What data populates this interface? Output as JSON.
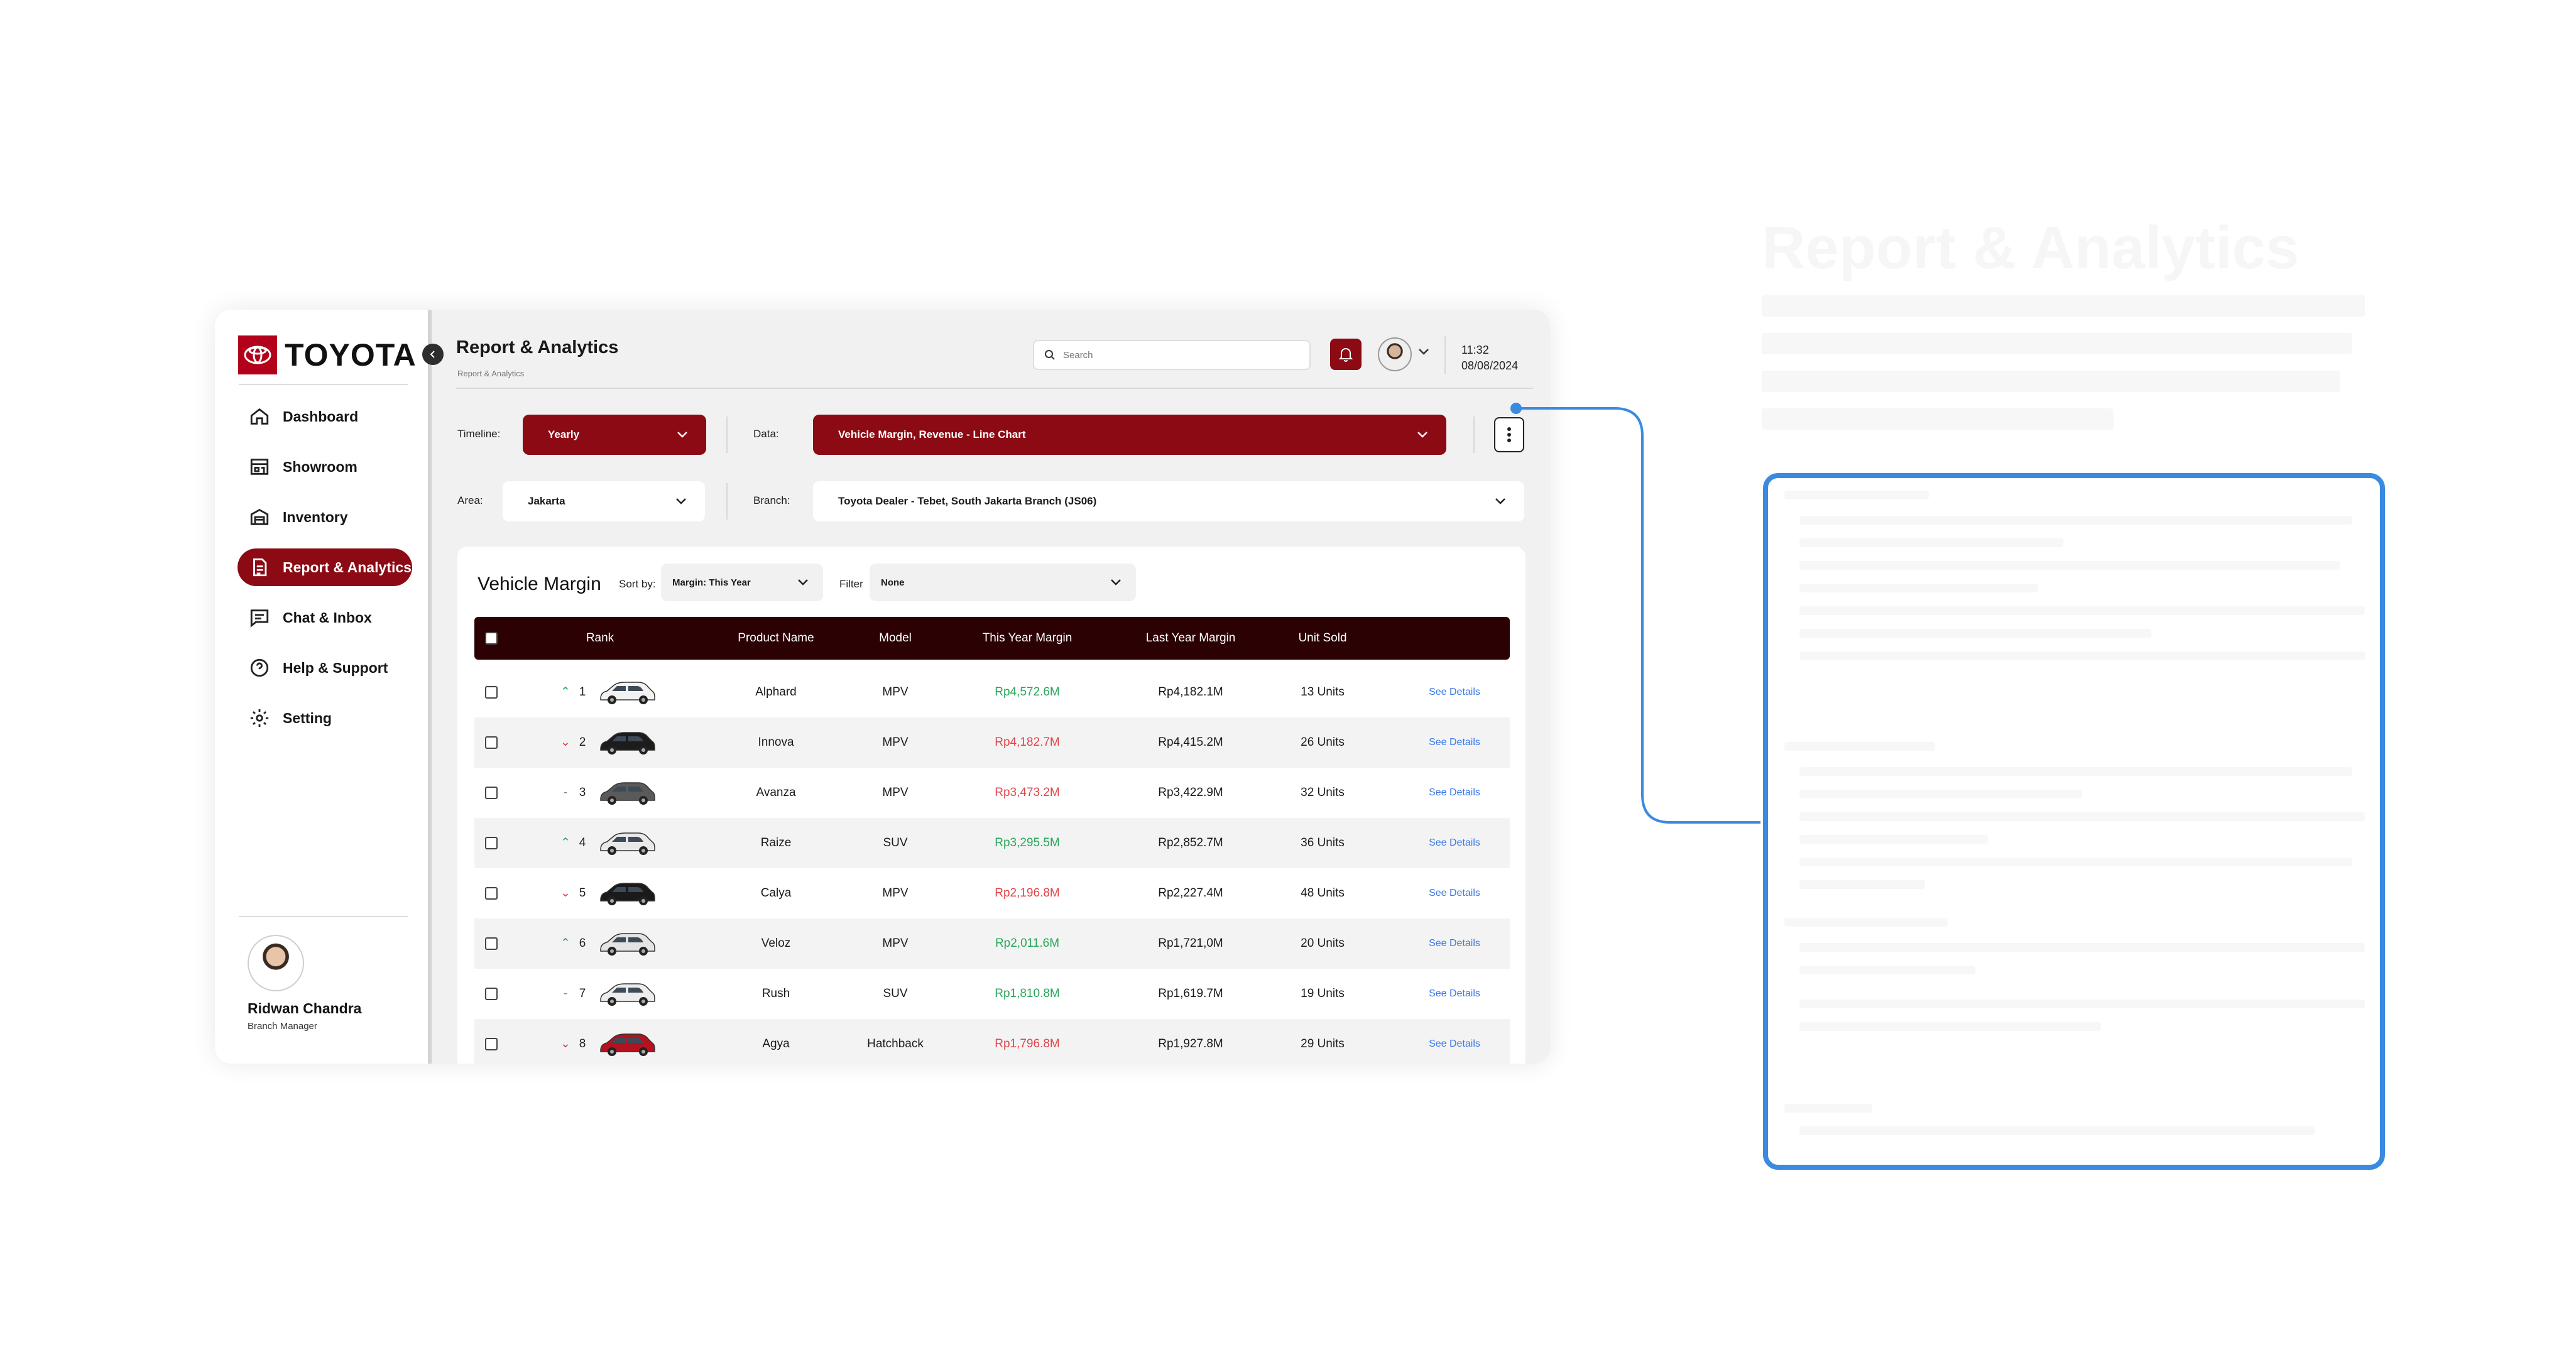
{
  "app": {
    "brand": "TOYOTA"
  },
  "sidebar": {
    "items": [
      {
        "label": "Dashboard",
        "icon": "home-icon",
        "active": false
      },
      {
        "label": "Showroom",
        "icon": "showroom-icon",
        "active": false
      },
      {
        "label": "Inventory",
        "icon": "warehouse-icon",
        "active": false
      },
      {
        "label": "Report & Analytics",
        "icon": "report-icon",
        "active": true
      },
      {
        "label": "Chat & Inbox",
        "icon": "chat-icon",
        "active": false
      },
      {
        "label": "Help & Support",
        "icon": "help-icon",
        "active": false
      },
      {
        "label": "Setting",
        "icon": "gear-icon",
        "active": false
      }
    ],
    "profile": {
      "name": "Ridwan Chandra",
      "role": "Branch Manager"
    }
  },
  "header": {
    "title": "Report & Analytics",
    "breadcrumb": "Report & Analytics",
    "search_placeholder": "Search",
    "time": "11:32",
    "date": "08/08/2024"
  },
  "filters": {
    "timeline_label": "Timeline:",
    "timeline_value": "Yearly",
    "data_label": "Data:",
    "data_value": "Vehicle Margin,  Revenue - Line Chart",
    "area_label": "Area:",
    "area_value": "Jakarta",
    "branch_label": "Branch:",
    "branch_value": "Toyota Dealer - Tebet, South Jakarta Branch  (JS06)"
  },
  "table_card": {
    "title": "Vehicle Margin",
    "sort_label": "Sort by:",
    "sort_value": "Margin: This Year",
    "filter_label": "Filter",
    "filter_value": "None",
    "columns": [
      "Rank",
      "Product Name",
      "Model",
      "This Year Margin",
      "Last Year Margin",
      "Unit Sold"
    ],
    "rows": [
      {
        "trend": "up",
        "rank": "1",
        "name": "Alphard",
        "model": "MPV",
        "this_year": "Rp4,572.6M",
        "this_year_color": "pos",
        "last_year": "Rp4,182.1M",
        "units": "13 Units",
        "action": "See Details",
        "car_color": "#f2f2f2"
      },
      {
        "trend": "down",
        "rank": "2",
        "name": "Innova",
        "model": "MPV",
        "this_year": "Rp4,182.7M",
        "this_year_color": "neg",
        "last_year": "Rp4,415.2M",
        "units": "26 Units",
        "action": "See Details",
        "car_color": "#1c1c1c"
      },
      {
        "trend": "flat",
        "rank": "3",
        "name": "Avanza",
        "model": "MPV",
        "this_year": "Rp3,473.2M",
        "this_year_color": "neg",
        "last_year": "Rp3,422.9M",
        "units": "32 Units",
        "action": "See Details",
        "car_color": "#5a5a5a"
      },
      {
        "trend": "up",
        "rank": "4",
        "name": "Raize",
        "model": "SUV",
        "this_year": "Rp3,295.5M",
        "this_year_color": "pos",
        "last_year": "Rp2,852.7M",
        "units": "36 Units",
        "action": "See Details",
        "car_color": "#e9e9e9"
      },
      {
        "trend": "down",
        "rank": "5",
        "name": "Calya",
        "model": "MPV",
        "this_year": "Rp2,196.8M",
        "this_year_color": "neg",
        "last_year": "Rp2,227.4M",
        "units": "48 Units",
        "action": "See Details",
        "car_color": "#1a1a1a"
      },
      {
        "trend": "up",
        "rank": "6",
        "name": "Veloz",
        "model": "MPV",
        "this_year": "Rp2,011.6M",
        "this_year_color": "pos",
        "last_year": "Rp1,721,0M",
        "units": "20 Units",
        "action": "See Details",
        "car_color": "#e4e4e4"
      },
      {
        "trend": "flat",
        "rank": "7",
        "name": "Rush",
        "model": "SUV",
        "this_year": "Rp1,810.8M",
        "this_year_color": "pos",
        "last_year": "Rp1,619.7M",
        "units": "19 Units",
        "action": "See Details",
        "car_color": "#ededed"
      },
      {
        "trend": "down",
        "rank": "8",
        "name": "Agya",
        "model": "Hatchback",
        "this_year": "Rp1,796.8M",
        "this_year_color": "neg",
        "last_year": "Rp1,927.8M",
        "units": "29 Units",
        "action": "See Details",
        "car_color": "#b3121f"
      }
    ]
  },
  "colors": {
    "brand_red": "#8c0a14",
    "table_header": "#2b0104",
    "positive": "#2aa55a",
    "negative": "#e0454a",
    "link": "#3b78e7",
    "annotation_blue": "#3a8be0"
  }
}
